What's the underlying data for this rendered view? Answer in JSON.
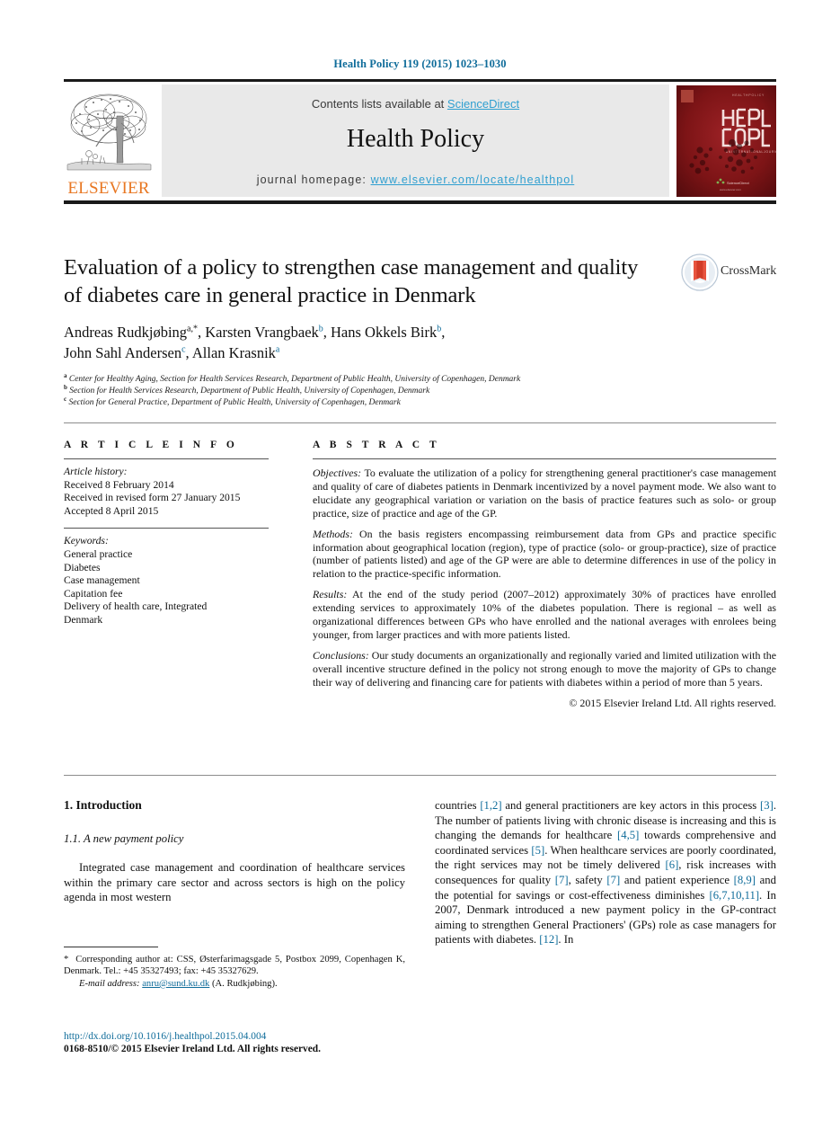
{
  "running_head": "Health Policy 119 (2015) 1023–1030",
  "masthead": {
    "contents_prefix": "Contents lists available at ",
    "sciencedirect": "ScienceDirect",
    "journal_name": "Health Policy",
    "homepage_prefix": "journal homepage: ",
    "homepage_url": "www.elsevier.com/locate/healthpol",
    "publisher": "ELSEVIER",
    "cover_line1": "HEALTH",
    "cover_line2": "POLICY",
    "accent_blue": "#2f9fd0",
    "link_blue": "#0f6c9a",
    "elsevier_orange": "#e87722",
    "cover_red": "#7d1416",
    "band_grey": "#e9e9e9"
  },
  "crossmark": {
    "label": "CrossMark"
  },
  "article": {
    "title": "Evaluation of a policy to strengthen case management and quality of diabetes care in general practice in Denmark",
    "authors_line1_parts": [
      {
        "name": "Andreas Rudkjøbing",
        "sup": "a,*"
      },
      {
        "name": "Karsten Vrangbaek",
        "sup": "b"
      },
      {
        "name": "Hans Okkels Birk",
        "sup": "b"
      }
    ],
    "authors_line2_parts": [
      {
        "name": "John Sahl Andersen",
        "sup": "c"
      },
      {
        "name": "Allan Krasnik",
        "sup": "a"
      }
    ],
    "affiliations": [
      {
        "mark": "a",
        "text": "Center for Healthy Aging, Section for Health Services Research, Department of Public Health, University of Copenhagen, Denmark"
      },
      {
        "mark": "b",
        "text": "Section for Health Services Research, Department of Public Health, University of Copenhagen, Denmark"
      },
      {
        "mark": "c",
        "text": "Section for General Practice, Department of Public Health, University of Copenhagen, Denmark"
      }
    ]
  },
  "article_info": {
    "heading": "A R T I C L E    I N F O",
    "history_label": "Article history:",
    "history": [
      "Received 8 February 2014",
      "Received in revised form 27 January 2015",
      "Accepted 8 April 2015"
    ],
    "keywords_label": "Keywords:",
    "keywords": [
      "General practice",
      "Diabetes",
      "Case management",
      "Capitation fee",
      "Delivery of health care, Integrated",
      "Denmark"
    ]
  },
  "abstract": {
    "heading": "A B S T R A C T",
    "sections": [
      {
        "run_in": "Objectives:",
        "text": " To evaluate the utilization of a policy for strengthening general practitioner's case management and quality of care of diabetes patients in Denmark incentivized by a novel payment mode. We also want to elucidate any geographical variation or variation on the basis of practice features such as solo- or group practice, size of practice and age of the GP."
      },
      {
        "run_in": "Methods:",
        "text": " On the basis registers encompassing reimbursement data from GPs and practice specific information about geographical location (region), type of practice (solo- or group-practice), size of practice (number of patients listed) and age of the GP were are able to determine differences in use of the policy in relation to the practice-specific information."
      },
      {
        "run_in": "Results:",
        "text": " At the end of the study period (2007–2012) approximately 30% of practices have enrolled extending services to approximately 10% of the diabetes population. There is regional – as well as organizational differences between GPs who have enrolled and the national averages with enrolees being younger, from larger practices and with more patients listed."
      },
      {
        "run_in": "Conclusions:",
        "text": " Our study documents an organizationally and regionally varied and limited utilization with the overall incentive structure defined in the policy not strong enough to move the majority of GPs to change their way of delivering and financing care for patients with diabetes within a period of more than 5 years."
      }
    ],
    "copyright": "© 2015 Elsevier Ireland Ltd. All rights reserved."
  },
  "body": {
    "section_heading": "1.  Introduction",
    "subsection_heading": "1.1.  A new payment policy",
    "left_paragraph": "Integrated case management and coordination of healthcare services within the primary care sector and across sectors is high on the policy agenda in most western",
    "right_paragraph_segments": [
      {
        "t": "countries "
      },
      {
        "t": "[1,2]",
        "ref": true
      },
      {
        "t": " and general practitioners are key actors in this process "
      },
      {
        "t": "[3]",
        "ref": true
      },
      {
        "t": ". The number of patients living with chronic disease is increasing and this is changing the demands for healthcare "
      },
      {
        "t": "[4,5]",
        "ref": true
      },
      {
        "t": " towards comprehensive and coordinated services "
      },
      {
        "t": "[5]",
        "ref": true
      },
      {
        "t": ". When healthcare services are poorly coordinated, the right services may not be timely delivered "
      },
      {
        "t": "[6]",
        "ref": true
      },
      {
        "t": ", risk increases with consequences for quality "
      },
      {
        "t": "[7]",
        "ref": true
      },
      {
        "t": ", safety "
      },
      {
        "t": "[7]",
        "ref": true
      },
      {
        "t": " and patient experience "
      },
      {
        "t": "[8,9]",
        "ref": true
      },
      {
        "t": " and the potential for savings or cost-effectiveness diminishes "
      },
      {
        "t": "[6,7,10,11]",
        "ref": true
      },
      {
        "t": ". In 2007, Denmark introduced a new payment policy in the GP-contract aiming to strengthen General Practioners' (GPs) role as case managers for patients with diabetes. "
      },
      {
        "t": "[12]",
        "ref": true
      },
      {
        "t": ". In"
      }
    ]
  },
  "footnote": {
    "star": "*",
    "corresponding": "Corresponding author at: CSS, Østerfarimagsgade 5, Postbox 2099, Copenhagen K, Denmark. Tel.: +45 35327493; fax: +45 35327629.",
    "email_label": "E-mail address:",
    "email": "anru@sund.ku.dk",
    "email_owner": "(A. Rudkjøbing)."
  },
  "footer": {
    "doi": "http://dx.doi.org/10.1016/j.healthpol.2015.04.004",
    "issn_line": "0168-8510/© 2015 Elsevier Ireland Ltd. All rights reserved."
  }
}
